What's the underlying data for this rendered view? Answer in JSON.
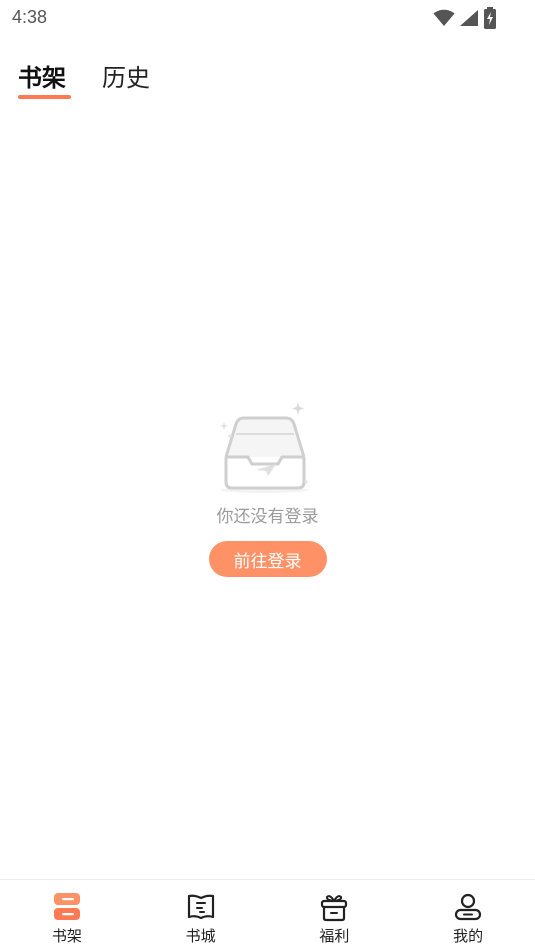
{
  "status_bar": {
    "time": "4:38"
  },
  "tabs": [
    {
      "label": "书架",
      "active": true
    },
    {
      "label": "历史",
      "active": false
    }
  ],
  "empty_state": {
    "message": "你还没有登录",
    "button_label": "前往登录"
  },
  "bottom_nav": [
    {
      "label": "书架",
      "icon": "bookshelf-icon",
      "active": true
    },
    {
      "label": "书城",
      "icon": "book-store-icon",
      "active": false
    },
    {
      "label": "福利",
      "icon": "gift-icon",
      "active": false
    },
    {
      "label": "我的",
      "icon": "profile-icon",
      "active": false
    }
  ],
  "colors": {
    "accent": "#ff7a52",
    "button": "#ff9166",
    "muted_text": "#9b9b9b"
  }
}
